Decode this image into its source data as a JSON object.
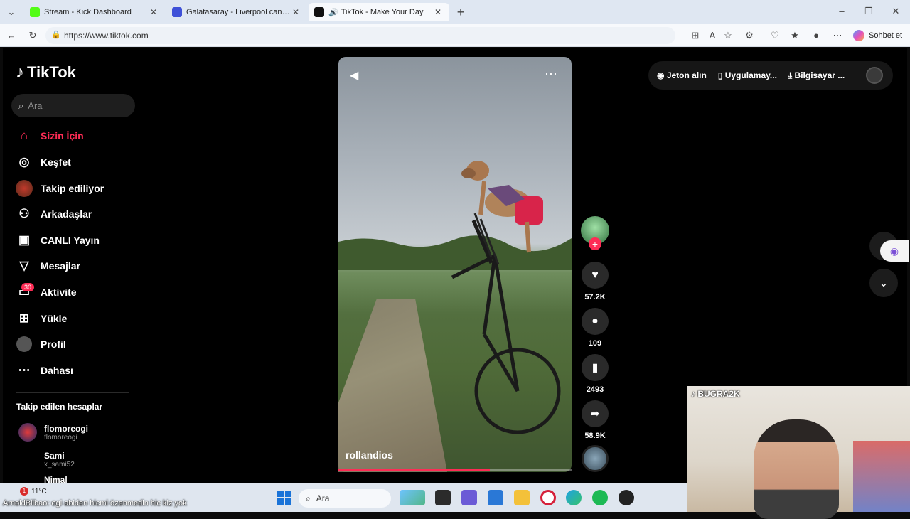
{
  "browser": {
    "tabs": [
      {
        "title": "Stream - Kick Dashboard",
        "active": false,
        "favicon_color": "#53fc18"
      },
      {
        "title": "Galatasaray - Liverpool canlı skor,",
        "active": false,
        "favicon_color": "#3f51d8"
      },
      {
        "title": "TikTok - Make Your Day",
        "active": true,
        "favicon_color": "#111111"
      }
    ],
    "url": "https://www.tiktok.com",
    "chat_label": "Sohbet et"
  },
  "tiktok": {
    "logo": "TikTok",
    "search_placeholder": "Ara",
    "nav": [
      {
        "label": "Sizin İçin",
        "icon": "home-icon",
        "active": true
      },
      {
        "label": "Keşfet",
        "icon": "compass-icon",
        "active": false
      },
      {
        "label": "Takip ediliyor",
        "icon": "following-avatar",
        "active": false
      },
      {
        "label": "Arkadaşlar",
        "icon": "friends-icon",
        "active": false
      },
      {
        "label": "CANLI Yayın",
        "icon": "live-icon",
        "active": false
      },
      {
        "label": "Mesajlar",
        "icon": "messages-icon",
        "active": false
      },
      {
        "label": "Aktivite",
        "icon": "activity-icon",
        "active": false
      },
      {
        "label": "Yükle",
        "icon": "upload-icon",
        "active": false
      },
      {
        "label": "Profil",
        "icon": "profile-avatar",
        "active": false
      },
      {
        "label": "Dahası",
        "icon": "more-icon",
        "active": false
      }
    ],
    "activity_badge": "30",
    "followed_title": "Takip edilen hesaplar",
    "followed": [
      {
        "name": "flomoreogi",
        "handle": "flomoreogi"
      },
      {
        "name": "Sami",
        "handle": "x_sami52"
      },
      {
        "name": "Nimal",
        "handle": ""
      }
    ],
    "topbar": {
      "coins": "Jeton alın",
      "app": "Uygulamay...",
      "desktop": "Bilgisayar ..."
    },
    "video": {
      "author": "rollandios",
      "progress": 0.65
    },
    "actions": {
      "likes": "57.2K",
      "comments": "109",
      "saves": "2493",
      "shares": "58.9K"
    }
  },
  "webcam": {
    "label": "BUGRA2K"
  },
  "taskbar": {
    "temperature": "11°C",
    "notification_count": "1",
    "ticker": "ArnoldBilbao: ogi abiden hicmi özenmedin hic kiz yok",
    "search": "Ara"
  }
}
